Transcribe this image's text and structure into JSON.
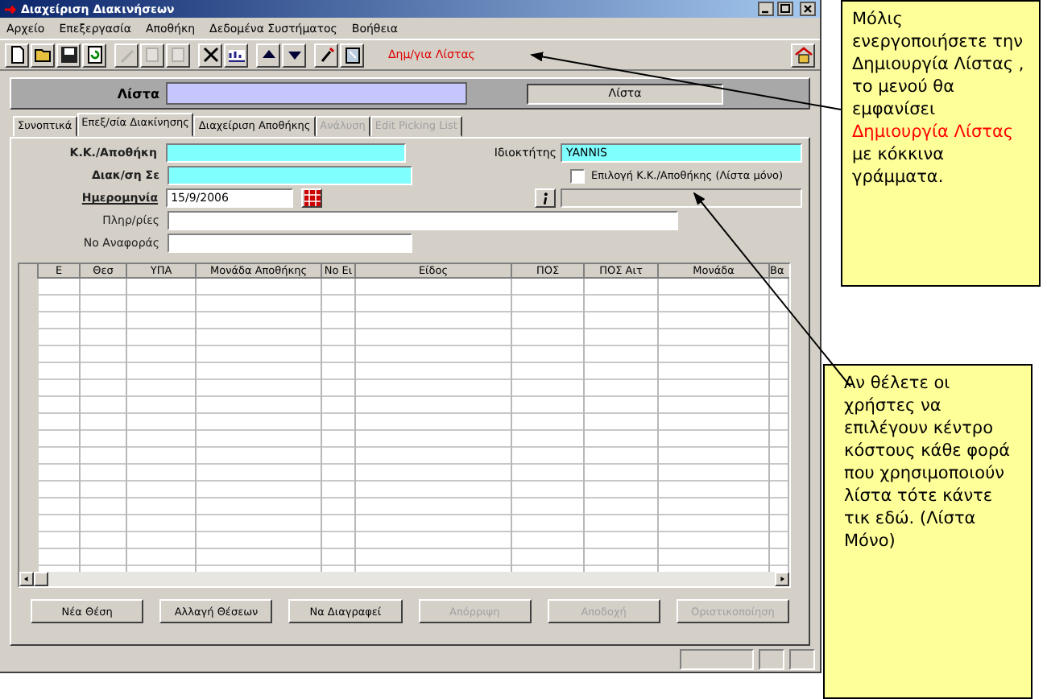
{
  "window": {
    "title": "Διαχείριση Διακινήσεων"
  },
  "menu": [
    "Αρχείο",
    "Επεξεργασία",
    "Αποθήκη",
    "Δεδομένα Συστήματος",
    "Βοήθεια"
  ],
  "toolbar": {
    "items": [
      {
        "kind": "new",
        "disabled": false
      },
      {
        "kind": "open",
        "disabled": false
      },
      {
        "kind": "save",
        "disabled": false
      },
      {
        "kind": "refresh",
        "disabled": false
      },
      {
        "kind": "edit",
        "disabled": true
      },
      {
        "kind": "copy",
        "disabled": true
      },
      {
        "kind": "paste",
        "disabled": true
      },
      {
        "kind": "delete",
        "disabled": false
      },
      {
        "kind": "info",
        "disabled": false
      },
      {
        "kind": "up",
        "disabled": false
      },
      {
        "kind": "down",
        "disabled": false
      },
      {
        "kind": "tools",
        "disabled": false
      },
      {
        "kind": "clipboard",
        "disabled": false
      }
    ],
    "mode_text": "Δημ/για Λίστας"
  },
  "header": {
    "label": "Λίστα",
    "status": "Λίστα"
  },
  "tabs": [
    {
      "label": "Συνοπτικά",
      "selected": false,
      "disabled": false
    },
    {
      "label": "Επεξ/σία Διακίνησης",
      "selected": true,
      "disabled": false
    },
    {
      "label": "Διαχείριση Αποθήκης",
      "selected": false,
      "disabled": false
    },
    {
      "label": "Ανάλυση",
      "selected": false,
      "disabled": true
    },
    {
      "label": "Edit Picking List",
      "selected": false,
      "disabled": true
    }
  ],
  "form": {
    "cost_center": {
      "label": "Κ.Κ./Αποθήκη"
    },
    "transfer_to": {
      "label": "Διακ/ση Σε"
    },
    "date": {
      "label": "Ημερομηνία",
      "value": "15/9/2006"
    },
    "info": {
      "label": "Πληρ/ρίες"
    },
    "reference": {
      "label": "Νο Αναφοράς"
    },
    "owner": {
      "label": "Ιδιοκτήτης",
      "value": "YANNIS"
    },
    "cost_center_choice": {
      "label": "Επιλογή Κ.Κ./Αποθήκης (Λίστα μόνο)",
      "checked": false
    }
  },
  "table": {
    "columns": [
      "Ε",
      "Θεσ",
      "ΥΠΑ",
      "Μονάδα Αποθήκης",
      "Νο Ει",
      "Είδος",
      "ΠΟΣ",
      "ΠΟΣ Αιτ",
      "Μονάδα",
      "Βα"
    ]
  },
  "buttons": [
    {
      "label": "Νέα Θέση",
      "disabled": false
    },
    {
      "label": "Αλλαγή Θέσεων",
      "disabled": false
    },
    {
      "label": "Να Διαγραφεί",
      "disabled": false
    },
    {
      "label": "Απόρριψη",
      "disabled": true
    },
    {
      "label": "Αποδοχή",
      "disabled": true
    },
    {
      "label": "Οριστικοποίηση",
      "disabled": true
    }
  ],
  "callouts": [
    {
      "parts": [
        {
          "text": "Μόλις ενεργοποιήσετε την Δημιουργία Λίστας , το μενού θα εμφανίσει ",
          "highlight": false
        },
        {
          "text": "Δημιουργία Λίστας",
          "highlight": true
        },
        {
          "text": " με κόκκινα γράμματα.",
          "highlight": false
        }
      ]
    },
    {
      "parts": [
        {
          "text": "Αν θέλετε οι χρήστες να επιλέγουν κέντρο κόστους κάθε φορά που χρησιμοποιούν λίστα τότε κάντε τικ εδώ. (Λίστα Μόνο)",
          "highlight": false
        }
      ]
    }
  ]
}
